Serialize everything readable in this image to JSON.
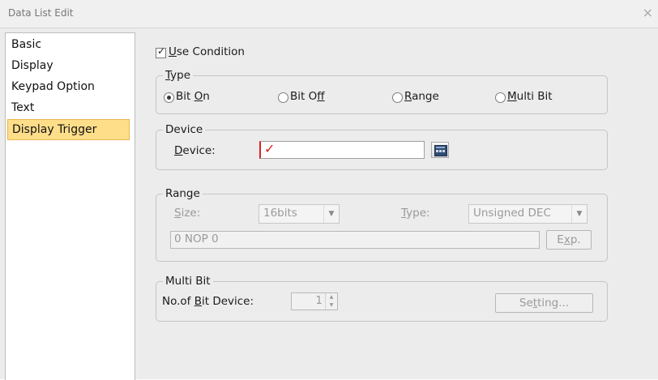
{
  "window": {
    "title": "Data List Edit",
    "close_glyph": "×"
  },
  "sidebar": {
    "items": [
      {
        "label": "Basic"
      },
      {
        "label": "Display"
      },
      {
        "label": "Keypad Option"
      },
      {
        "label": "Text"
      },
      {
        "label": "Display Trigger",
        "selected": true
      }
    ]
  },
  "use_condition": {
    "label_mnemonic": "U",
    "label_rest": "se Condition",
    "checked": true
  },
  "type_group": {
    "legend_mnemonic": "T",
    "legend_rest": "ype",
    "options": [
      {
        "pre": "Bit ",
        "mnemonic": "O",
        "post": "n",
        "selected": true
      },
      {
        "pre": "Bit O",
        "mnemonic": "f",
        "post": "f",
        "selected": false
      },
      {
        "pre": "",
        "mnemonic": "R",
        "post": "ange",
        "selected": false
      },
      {
        "pre": "",
        "mnemonic": "M",
        "post": "ulti Bit",
        "selected": false
      }
    ]
  },
  "device_group": {
    "legend": "Device",
    "label_mnemonic": "D",
    "label_rest": "evice:",
    "value": "",
    "mark_glyph": "✓",
    "button_icon": "device-picker-icon"
  },
  "range_group": {
    "legend": "Range",
    "size_label_mnemonic": "S",
    "size_label_rest": "ize:",
    "size_value": "16bits",
    "type_label_mnemonic": "T",
    "type_label_rest": "ype:",
    "type_value": "Unsigned DEC",
    "expression": "0 NOP 0",
    "exp_pre": "E",
    "exp_mnemonic": "x",
    "exp_post": "p."
  },
  "multibit_group": {
    "legend": "Multi Bit",
    "label_pre": "No.of ",
    "label_mnemonic": "B",
    "label_post": "it Device:",
    "count": "1",
    "setting_pre": "Se",
    "setting_mnemonic": "t",
    "setting_post": "ting..."
  },
  "colors": {
    "selected_item_bg": "#ffde8a",
    "dialog_bg": "#ececec",
    "required_mark": "#d91e1e"
  }
}
